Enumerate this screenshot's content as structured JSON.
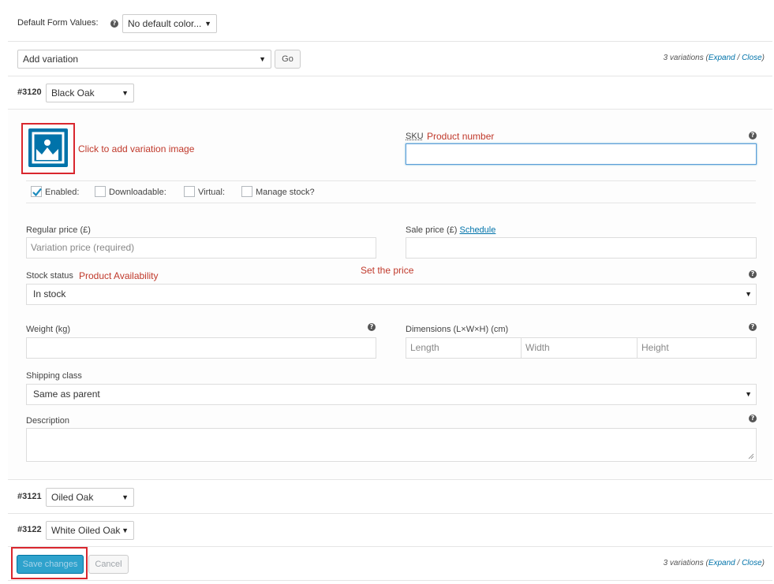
{
  "defaults": {
    "label": "Default Form Values:",
    "select_value": "No default color..."
  },
  "toolbar": {
    "add_variation": "Add variation",
    "go": "Go",
    "variations_count": "3 variations",
    "expand": "Expand",
    "close": "Close"
  },
  "variation1": {
    "id": "#3120",
    "select_value": "Black Oak",
    "image_annotation": "Click to add variation image",
    "sku_label": "SKU",
    "sku_annotation": "Product number",
    "sku_value": "",
    "enabled": "Enabled:",
    "downloadable": "Downloadable:",
    "virtual": "Virtual:",
    "manage_stock": "Manage stock?",
    "regular_price_label": "Regular price (£)",
    "regular_price_placeholder": "Variation price (required)",
    "sale_price_label": "Sale price (£)",
    "schedule_link": "Schedule",
    "price_annotation": "Set the price",
    "stock_status_label": "Stock status",
    "stock_annotation": "Product Availability",
    "stock_status_value": "In stock",
    "weight_label": "Weight (kg)",
    "dimensions_label": "Dimensions (L×W×H) (cm)",
    "length_placeholder": "Length",
    "width_placeholder": "Width",
    "height_placeholder": "Height",
    "shipping_class_label": "Shipping class",
    "shipping_class_value": "Same as parent",
    "description_label": "Description"
  },
  "variation2": {
    "id": "#3121",
    "select_value": "Oiled Oak"
  },
  "variation3": {
    "id": "#3122",
    "select_value": "White Oiled Oak"
  },
  "footer": {
    "save": "Save changes",
    "cancel": "Cancel",
    "variations_count": "3 variations",
    "expand": "Expand",
    "close": "Close"
  },
  "colors": {
    "accent": "#0073aa",
    "annotation_red": "#c0392b",
    "save_button": "#2ea2cc",
    "image_icon": "#0073aa"
  }
}
